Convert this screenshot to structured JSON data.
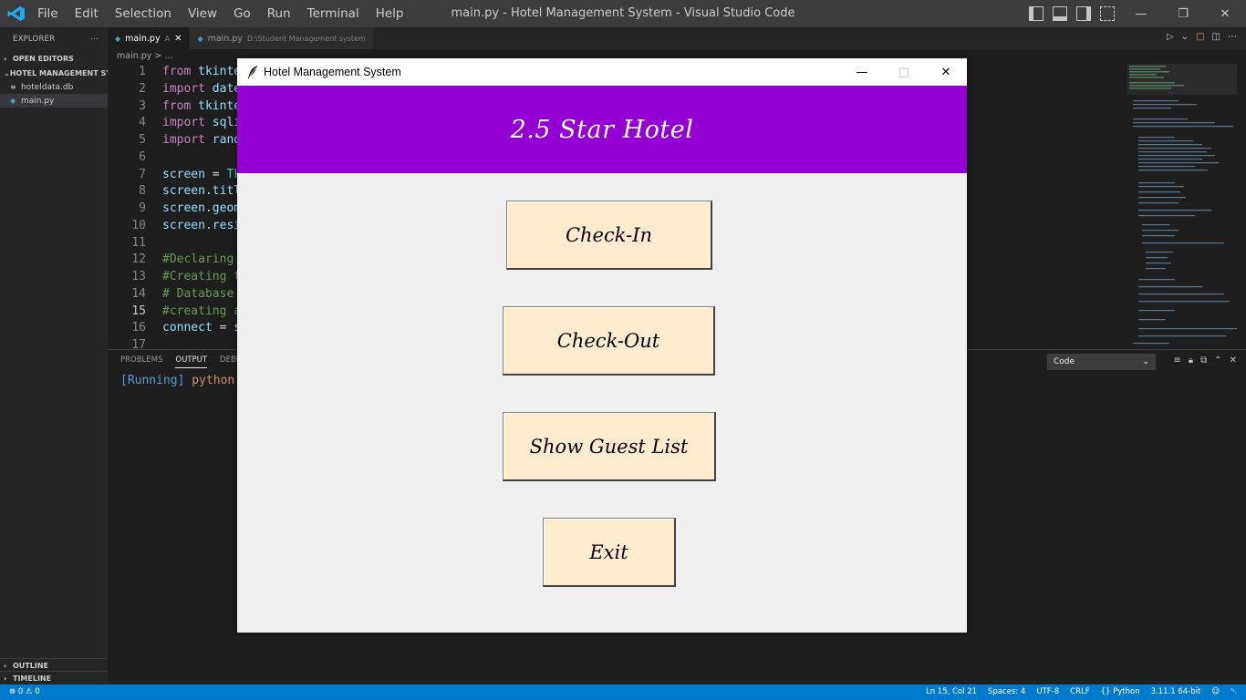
{
  "vscode": {
    "menu": [
      "File",
      "Edit",
      "Selection",
      "View",
      "Go",
      "Run",
      "Terminal",
      "Help"
    ],
    "window_title": "main.py - Hotel Management System - Visual Studio Code",
    "explorer_label": "EXPLORER",
    "open_editors": "OPEN EDITORS",
    "project": "HOTEL MANAGEMENT SYS...",
    "files": [
      "hoteldata.db",
      "main.py"
    ],
    "outline": "OUTLINE",
    "timeline": "TIMELINE",
    "tabs": [
      {
        "label": "main.py",
        "badge": "A",
        "sub": ""
      },
      {
        "label": "main.py",
        "badge": "",
        "sub": "D:\\Student Management system"
      }
    ],
    "breadcrumb": "main.py > ...",
    "panel_tabs": [
      "PROBLEMS",
      "OUTPUT",
      "DEBUG C"
    ],
    "panel_select": "Code",
    "output_running": "[Running]",
    "output_cmd": "python",
    "status_left": "⊗ 0 ⚠ 0",
    "status_right": [
      "Ln 15, Col 21",
      "Spaces: 4",
      "UTF-8",
      "CRLF",
      "{} Python",
      "3.11.1 64-bit"
    ]
  },
  "tk": {
    "window_title": "Hotel Management System",
    "heading": "2.5 Star Hotel",
    "buttons": {
      "checkin": "Check-In",
      "checkout": "Check-Out",
      "guests": "Show Guest List",
      "exit": "Exit"
    },
    "header_color": "#9400d3",
    "button_color": "#ffebcd"
  }
}
